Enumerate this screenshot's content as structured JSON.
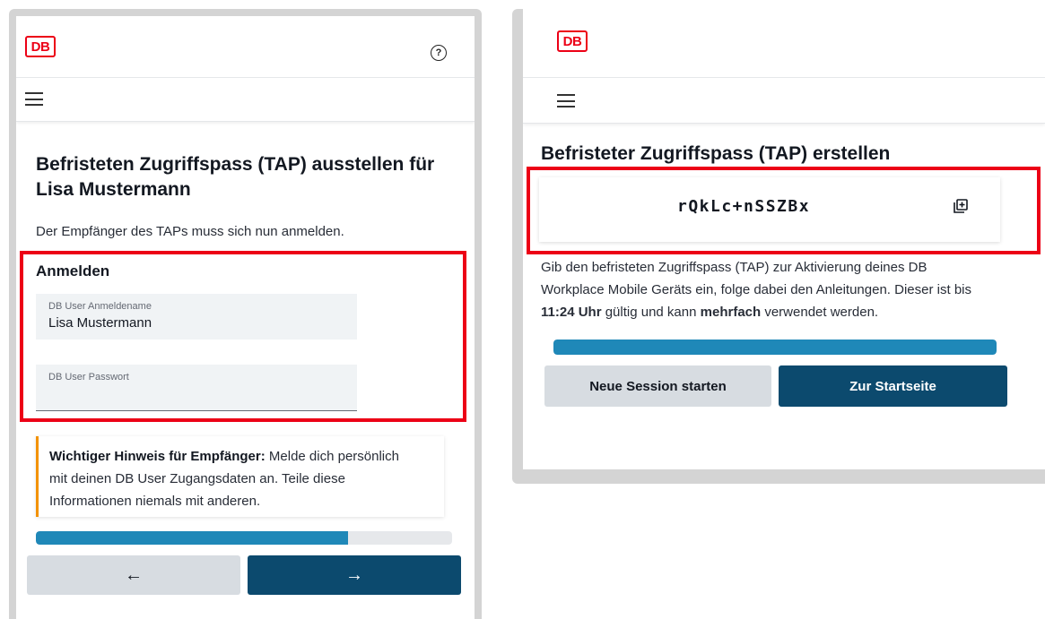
{
  "left": {
    "brand": "DB",
    "help_icon": "help-icon",
    "menu_icon": "hamburger-menu-icon",
    "title_line1": "Befristeten Zugriffspass (TAP) ausstellen für",
    "title_line2": "Lisa Mustermann",
    "intro": "Der Empfänger des TAPs muss sich nun anmelden.",
    "login": {
      "heading": "Anmelden",
      "username_label": "DB User Anmeldename",
      "username_value": "Lisa Mustermann",
      "password_label": "DB User Passwort",
      "password_value": ""
    },
    "notice": {
      "bold": "Wichtiger Hinweis für Empfänger:",
      "text1": " Melde dich persönlich",
      "line2": "mit deinen DB User Zugangsdaten an. Teile diese",
      "line3": "Informationen niemals mit anderen."
    },
    "progress_percent": 75,
    "back_button": "←",
    "next_button": "→"
  },
  "right": {
    "brand": "DB",
    "menu_icon": "hamburger-menu-icon",
    "title": "Befristeter Zugriffspass (TAP) erstellen",
    "tap_code": "rQkLc+nSSZBx",
    "copy_icon": "copy-icon",
    "desc_line1": "Gib den befristeten Zugriffspass (TAP) zur Aktivierung deines DB",
    "desc_line2": "Workplace Mobile Geräts ein, folge dabei den Anleitungen. Dieser ist bis",
    "desc_time": "11:24 Uhr",
    "desc_mid": " gültig und kann ",
    "desc_multi": "mehrfach",
    "desc_end": " verwendet werden.",
    "progress_percent": 100,
    "new_session_button": "Neue Session starten",
    "home_button": "Zur Startseite"
  },
  "colors": {
    "db_red": "#ec0016",
    "primary_button": "#0c4a6e",
    "progress": "#1f88b8",
    "notice_accent": "#f39200"
  }
}
